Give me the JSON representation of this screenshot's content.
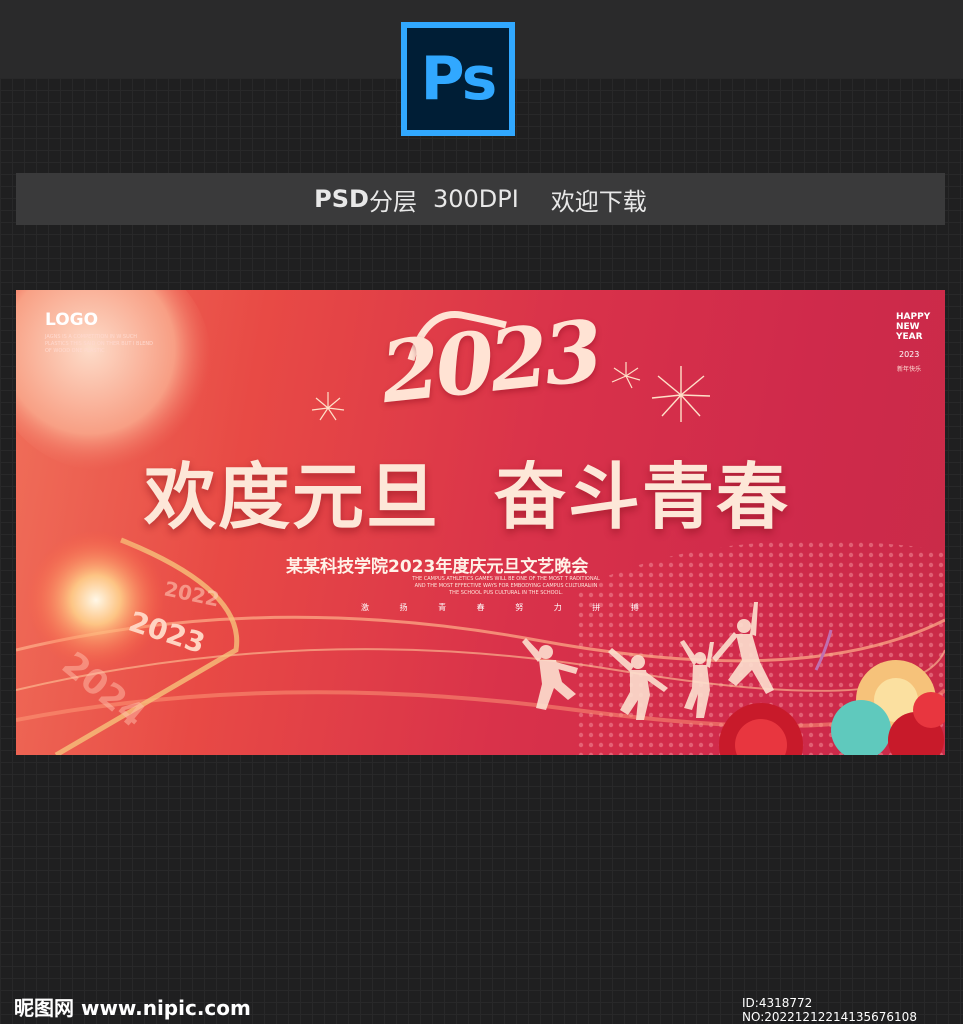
{
  "app_icon": {
    "name": "photoshop-icon",
    "label": "Ps",
    "color": "#31a8ff"
  },
  "info_bar": {
    "psd": "PSD",
    "layered": "分层",
    "dpi": "300DPI",
    "welcome": "欢迎下载"
  },
  "banner": {
    "logo": "LOGO",
    "logo_sub": "JAGNS IS A COMPETITION IN W SUCH PLASTICS THIS SAID ON THER BUT I BLEND OF WOOD ONE PLASTIC",
    "happy": "HAPPY NEW YEAR",
    "happy_year": "2023",
    "happy_sub": "新年快乐",
    "year": "2023",
    "title_1": "欢度元旦",
    "title_2": "奋斗青春",
    "subtitle": "某某科技学院2023年度庆元旦文艺晚会",
    "english": "THE CAMPUS ATHLETICS GAMES WILL BE ONE OF THE MOST T RADITIONAL AND THE MOST EFFECTIVE WAYS FOR EMBODYING CAMPUS CULTURAL IN THE SCHOOL PUS CULTURAL IN THE SCHOOL.",
    "slogan": [
      "激",
      "扬",
      "青",
      "春",
      "努",
      "力",
      "拼",
      "搏"
    ],
    "tick_2022": "2022",
    "tick_2023": "2023",
    "tick_2024": "2024",
    "colors": {
      "primary": "#d9324a",
      "accent": "#fde7d8",
      "gold": "#f6c27a"
    }
  },
  "watermark": {
    "left": "昵图网 www.nipic.com",
    "right": "ID:4318772 NO:20221212214135676108"
  }
}
